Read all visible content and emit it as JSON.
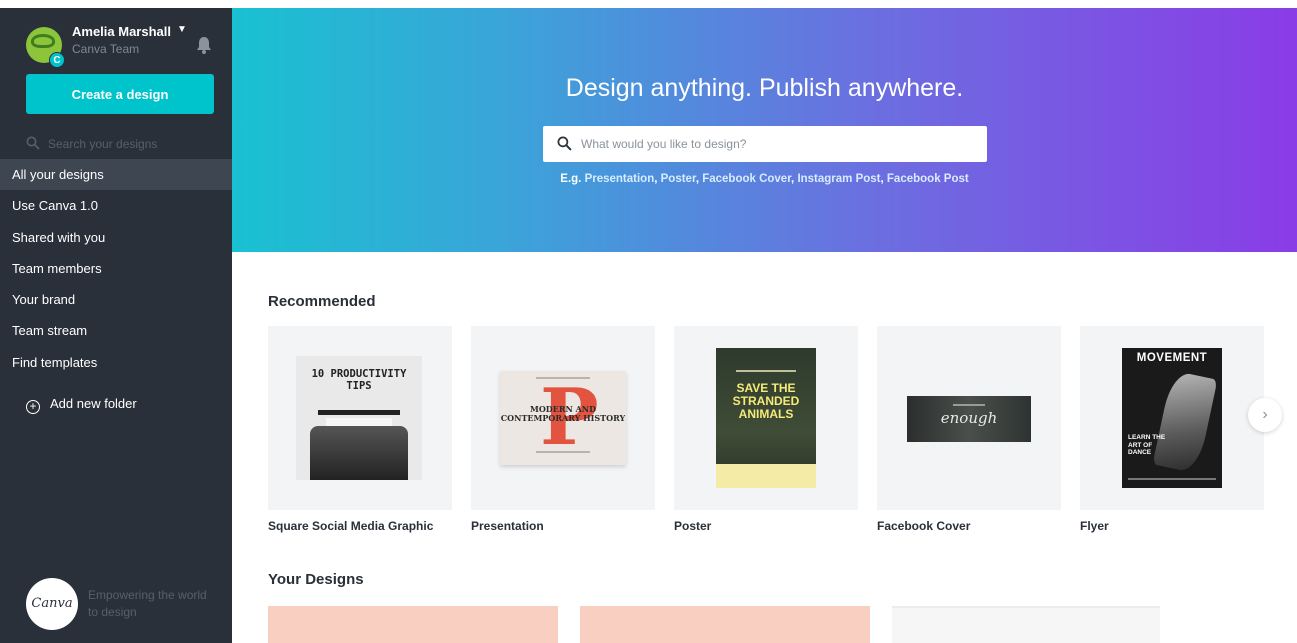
{
  "user": {
    "name": "Amelia Marshall",
    "team": "Canva Team",
    "badge": "C"
  },
  "sidebar": {
    "create_label": "Create a design",
    "search_placeholder": "Search your designs",
    "items": [
      {
        "label": "All your designs",
        "active": true
      },
      {
        "label": "Use Canva 1.0"
      },
      {
        "label": "Shared with you"
      },
      {
        "label": "Team members"
      },
      {
        "label": "Your brand"
      },
      {
        "label": "Team stream"
      },
      {
        "label": "Find templates"
      }
    ],
    "add_folder_label": "Add new folder",
    "brand_logo": "Canva",
    "brand_tagline": "Empowering the world to design"
  },
  "hero": {
    "title": "Design anything. Publish anywhere.",
    "search_placeholder": "What would you like to design?",
    "eg_label": "E.g.",
    "examples": [
      "Presentation",
      "Poster",
      "Facebook Cover",
      "Instagram Post",
      "Facebook Post"
    ]
  },
  "recommended": {
    "title": "Recommended",
    "cards": [
      {
        "label": "Square Social Media Graphic",
        "thumb_text": "10 PRODUCTIVITY TIPS"
      },
      {
        "label": "Presentation",
        "thumb_text": "MODERN AND CONTEMPORARY HISTORY",
        "thumb_letter": "P"
      },
      {
        "label": "Poster",
        "thumb_text": "SAVE THE STRANDED ANIMALS"
      },
      {
        "label": "Facebook Cover",
        "thumb_text": "enough"
      },
      {
        "label": "Flyer",
        "thumb_text": "MOVEMENT",
        "thumb_subtext": "LEARN THE ART OF DANCE"
      }
    ],
    "next_icon": "›"
  },
  "your_designs": {
    "title": "Your Designs"
  },
  "colors": {
    "sidebar": "#293039",
    "accent": "#00c4cc",
    "hero_start": "#19c1d1",
    "hero_end": "#8a3ce6"
  },
  "icons": {
    "search": "search-icon",
    "bell": "bell-icon",
    "chevron": "chevron-right-icon",
    "caret": "caret-down-icon",
    "plus": "plus-circle-icon"
  }
}
